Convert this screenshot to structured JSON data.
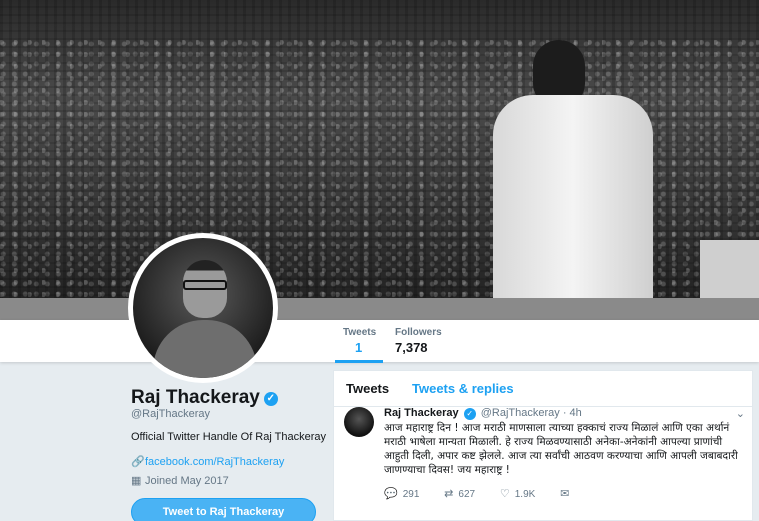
{
  "profile": {
    "name": "Raj Thackeray",
    "handle": "@RajThackeray",
    "bio": "Official Twitter Handle Of Raj Thackeray",
    "link": "facebook.com/RajThackeray",
    "joined": "Joined May 2017",
    "tweet_to_label": "Tweet to Raj Thackeray",
    "verified_glyph": "✓"
  },
  "stats": {
    "tweets_label": "Tweets",
    "tweets_value": "1",
    "followers_label": "Followers",
    "followers_value": "7,378"
  },
  "timeline": {
    "tab_tweets": "Tweets",
    "tab_replies": "Tweets & replies",
    "tweet": {
      "name": "Raj Thackeray",
      "handle": "@RajThackeray",
      "time": "· 4h",
      "text": "आज महाराष्ट्र दिन ! आज मराठी माणसाला त्याच्या हक्काचं राज्य मिळालं आणि एका अर्थानं मराठी भाषेला मान्यता मिळाली. हे राज्य मिळवण्यासाठी अनेका-अनेकांनी आपल्या प्राणांची आहुती दिली, अपार कष्ट झेलले. आज त्या सर्वांची आठवण करण्याचा आणि आपली जबाबदारी जाणण्याचा दिवस! जय महाराष्ट्र !",
      "replies": "291",
      "retweets": "627",
      "likes": "1.9K"
    }
  },
  "icons": {
    "link": "link-icon",
    "calendar": "calendar-icon",
    "reply": "reply-icon",
    "retweet": "retweet-icon",
    "like": "heart-icon",
    "message": "message-icon",
    "caret": "chevron-down-icon"
  },
  "colors": {
    "accent": "#1da1f2",
    "background": "#e6ecf0"
  }
}
